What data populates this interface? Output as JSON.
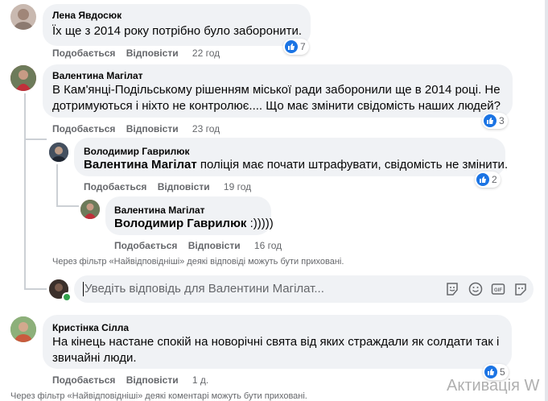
{
  "comments": [
    {
      "author": "Лена Явдосюк",
      "text": "Їх ще з 2014 року потрібно було заборонити.",
      "like_label": "Подобається",
      "reply_label": "Відповісти",
      "time": "22 год",
      "reactions": "7"
    },
    {
      "author": "Валентина Магілат",
      "text": "В Кам'янці-Подільському рішенням міської ради заборонили ще в 2014 році. Не дотримуються і ніхто не контролює.... Що має змінити свідомість наших людей?",
      "like_label": "Подобається",
      "reply_label": "Відповісти",
      "time": "23 год",
      "reactions": "3"
    },
    {
      "author": "Кристінка Сілла",
      "text": "На кінець настане спокій на новорічні свята від яких страждали як солдати так і звичайні люди.",
      "like_label": "Подобається",
      "reply_label": "Відповісти",
      "time": "1 д.",
      "reactions": "5"
    }
  ],
  "replies": [
    {
      "author": "Володимир Гаврилюк",
      "mention": "Валентина Магілат",
      "text": " поліція має почати штрафувати, свідомість не змінити.",
      "like_label": "Подобається",
      "reply_label": "Відповісти",
      "time": "19 год",
      "reactions": "2"
    },
    {
      "author": "Валентина Магілат",
      "mention": "Володимир Гаврилюк",
      "text": " :)))))",
      "like_label": "Подобається",
      "reply_label": "Відповісти",
      "time": "16 год"
    }
  ],
  "replies_hidden_note": "Через фільтр «Найвідповідніші» деякі відповіді можуть бути приховані.",
  "reply_input": {
    "placeholder": "Уведіть відповідь для Валентини Магілат..."
  },
  "comments_hidden_note": "Через фільтр «Найвідповідніші» деякі коментарі можуть бути приховані.",
  "watermark": "Активація W",
  "colors": {
    "bubble": "#f0f2f5",
    "like_blue": "#1b74e4",
    "secondary_text": "#65676b"
  }
}
